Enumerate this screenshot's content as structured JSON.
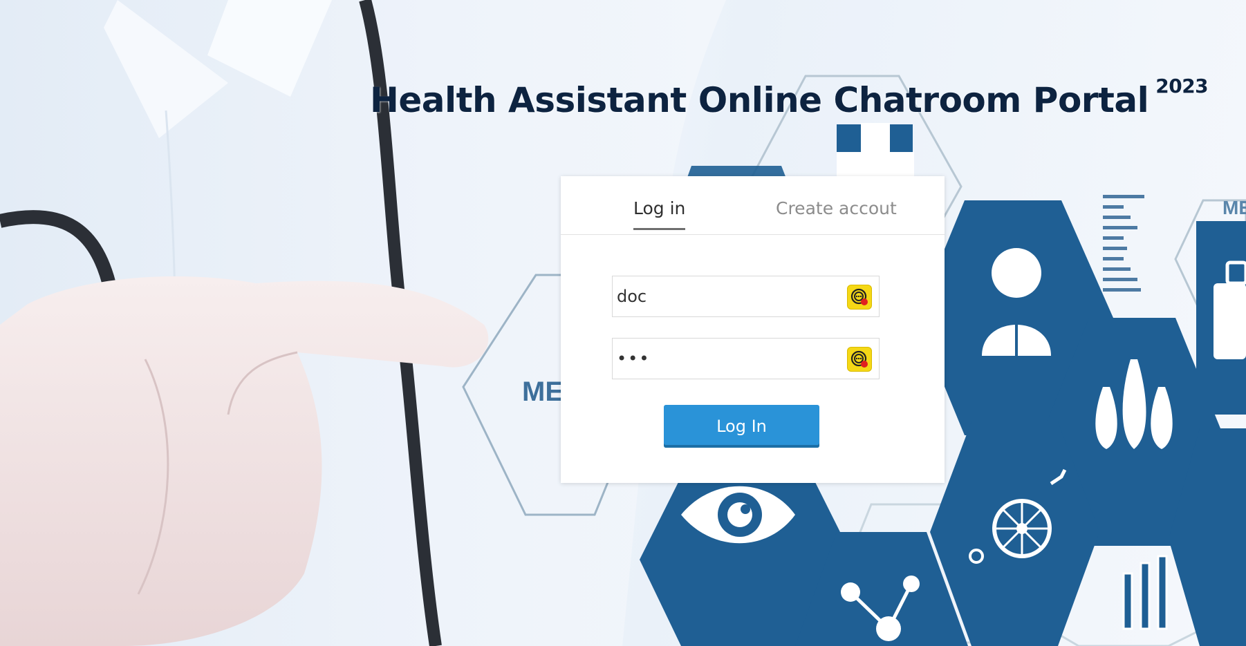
{
  "header": {
    "title": "Health Assistant Online Chatroom Portal",
    "year": "2023"
  },
  "tabs": {
    "login_label": "Log in",
    "create_label": "Create accout"
  },
  "form": {
    "username_value": "doc",
    "password_value": "•••",
    "submit_label": "Log In"
  },
  "background": {
    "hexagon_text": "ME",
    "hexagon_text_right": "ME",
    "icons": [
      "cross-icon",
      "person-icon",
      "drops-icon",
      "eye-icon",
      "molecule-icon",
      "wheelchair-icon",
      "test-tubes-icon",
      "suitcase-icon"
    ]
  },
  "colors": {
    "title": "#0d2340",
    "button": "#2a93d8",
    "hex_blue": "#1f5f94",
    "badge": "#f5d816"
  }
}
